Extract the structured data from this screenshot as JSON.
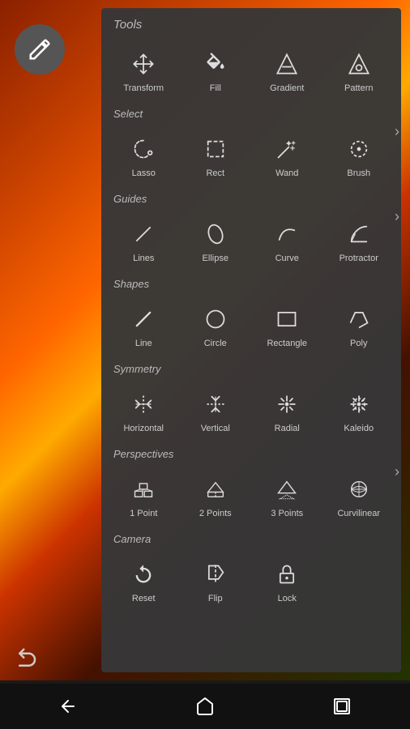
{
  "panel": {
    "title": "Tools",
    "sections": [
      {
        "label": null,
        "items": [
          {
            "id": "transform",
            "label": "Transform",
            "icon": "move"
          },
          {
            "id": "fill",
            "label": "Fill",
            "icon": "fill"
          },
          {
            "id": "gradient",
            "label": "Gradient",
            "icon": "gradient"
          },
          {
            "id": "pattern",
            "label": "Pattern",
            "icon": "pattern"
          }
        ]
      },
      {
        "label": "Select",
        "items": [
          {
            "id": "lasso",
            "label": "Lasso",
            "icon": "lasso"
          },
          {
            "id": "rect",
            "label": "Rect",
            "icon": "rect-select"
          },
          {
            "id": "wand",
            "label": "Wand",
            "icon": "wand"
          },
          {
            "id": "brush",
            "label": "Brush",
            "icon": "brush-select"
          }
        ],
        "hasChevron": true
      },
      {
        "label": "Guides",
        "items": [
          {
            "id": "lines",
            "label": "Lines",
            "icon": "lines"
          },
          {
            "id": "ellipse",
            "label": "Ellipse",
            "icon": "ellipse-guide"
          },
          {
            "id": "curve",
            "label": "Curve",
            "icon": "curve"
          },
          {
            "id": "protractor",
            "label": "Protractor",
            "icon": "protractor"
          }
        ],
        "hasChevron": true
      },
      {
        "label": "Shapes",
        "items": [
          {
            "id": "line",
            "label": "Line",
            "icon": "line"
          },
          {
            "id": "circle",
            "label": "Circle",
            "icon": "circle"
          },
          {
            "id": "rectangle",
            "label": "Rectangle",
            "icon": "rectangle"
          },
          {
            "id": "poly",
            "label": "Poly",
            "icon": "poly"
          }
        ]
      },
      {
        "label": "Symmetry",
        "items": [
          {
            "id": "horizontal",
            "label": "Horizontal",
            "icon": "sym-horizontal"
          },
          {
            "id": "vertical",
            "label": "Vertical",
            "icon": "sym-vertical"
          },
          {
            "id": "radial",
            "label": "Radial",
            "icon": "sym-radial"
          },
          {
            "id": "kaleido",
            "label": "Kaleido",
            "icon": "sym-kaleido"
          }
        ]
      },
      {
        "label": "Perspectives",
        "items": [
          {
            "id": "1point",
            "label": "1 Point",
            "icon": "persp-1"
          },
          {
            "id": "2points",
            "label": "2 Points",
            "icon": "persp-2"
          },
          {
            "id": "3points",
            "label": "3 Points",
            "icon": "persp-3"
          },
          {
            "id": "curvilinear",
            "label": "Curvilinear",
            "icon": "persp-curv"
          }
        ],
        "hasChevron": true
      },
      {
        "label": "Camera",
        "items": [
          {
            "id": "reset",
            "label": "Reset",
            "icon": "cam-reset"
          },
          {
            "id": "flip",
            "label": "Flip",
            "icon": "cam-flip"
          },
          {
            "id": "lock",
            "label": "Lock",
            "icon": "cam-lock"
          }
        ]
      }
    ]
  },
  "nav": {
    "back": "‹",
    "home": "⌂",
    "recents": "▣"
  }
}
